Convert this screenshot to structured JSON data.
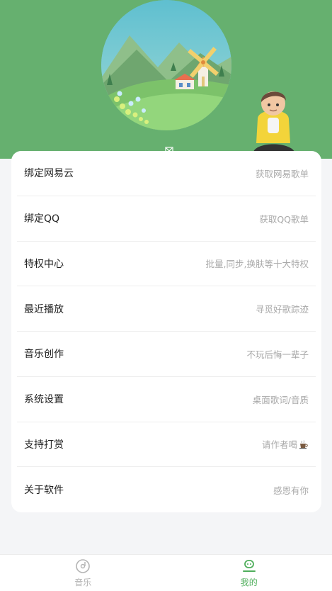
{
  "colors": {
    "header_bg": "#66b06f",
    "accent": "#4fae5b",
    "muted": "#b4b4b4",
    "page_bg": "#f4f5f7"
  },
  "menu": [
    {
      "title": "绑定网易云",
      "subtitle": "获取网易歌单"
    },
    {
      "title": "绑定QQ",
      "subtitle": "获取QQ歌单"
    },
    {
      "title": "特权中心",
      "subtitle": "批量,同步,换肤等十大特权"
    },
    {
      "title": "最近播放",
      "subtitle": "寻觅好歌踪迹"
    },
    {
      "title": "音乐创作",
      "subtitle": "不玩后悔一辈子"
    },
    {
      "title": "系统设置",
      "subtitle": "桌面歌词/音质"
    },
    {
      "title": "支持打赏",
      "subtitle": "请作者喝",
      "icon": "coffee-cup-icon"
    },
    {
      "title": "关于软件",
      "subtitle": "感恩有你"
    }
  ],
  "tabs": [
    {
      "label": "音乐",
      "icon": "vinyl-disc-icon",
      "active": false
    },
    {
      "label": "我的",
      "icon": "user-profile-icon",
      "active": true
    }
  ]
}
